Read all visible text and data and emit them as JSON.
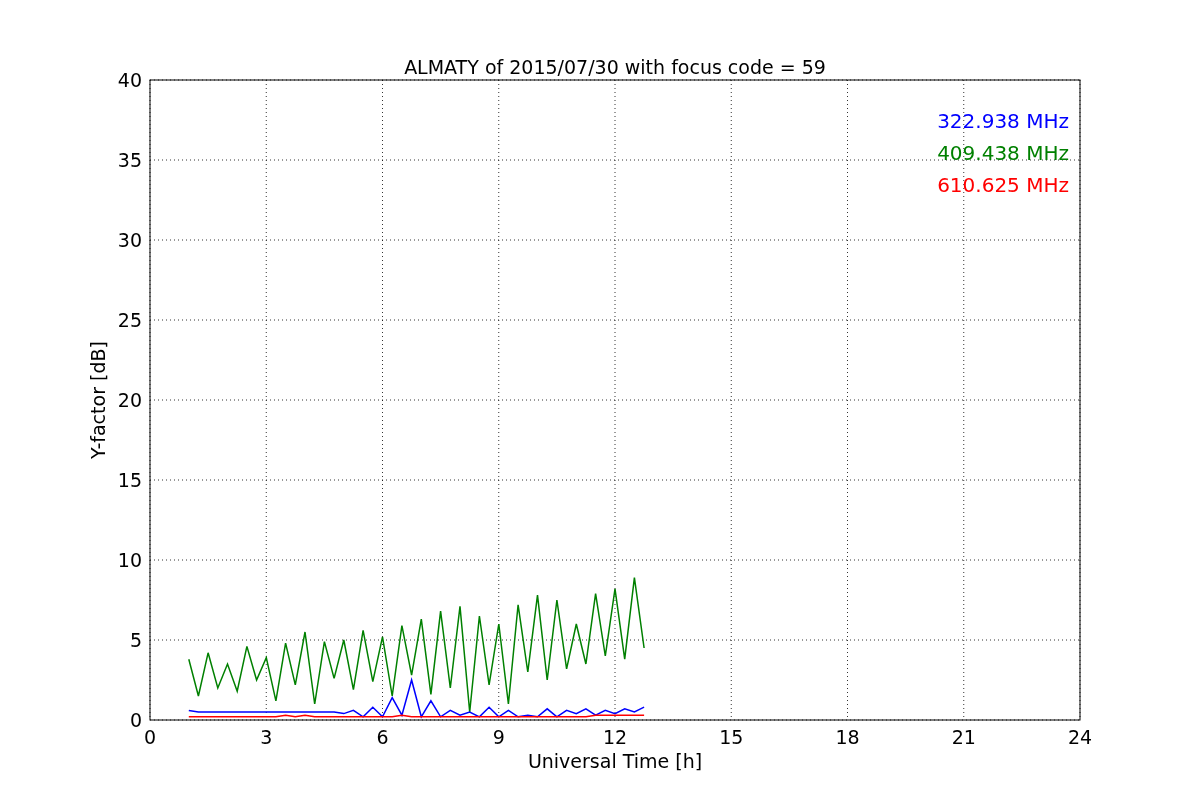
{
  "chart_data": {
    "type": "line",
    "title": "ALMATY of 2015/07/30 with focus code = 59",
    "xlabel": "Universal Time [h]",
    "ylabel": "Y-factor [dB]",
    "xlim": [
      0,
      24
    ],
    "ylim": [
      0,
      40
    ],
    "xticks": [
      0,
      3,
      6,
      9,
      12,
      15,
      18,
      21,
      24
    ],
    "yticks": [
      0,
      5,
      10,
      15,
      20,
      25,
      30,
      35,
      40
    ],
    "grid": true,
    "x": [
      1.0,
      1.25,
      1.5,
      1.75,
      2.0,
      2.25,
      2.5,
      2.75,
      3.0,
      3.25,
      3.5,
      3.75,
      4.0,
      4.25,
      4.5,
      4.75,
      5.0,
      5.25,
      5.5,
      5.75,
      6.0,
      6.25,
      6.5,
      6.75,
      7.0,
      7.25,
      7.5,
      7.75,
      8.0,
      8.25,
      8.5,
      8.75,
      9.0,
      9.25,
      9.5,
      9.75,
      10.0,
      10.25,
      10.5,
      10.75,
      11.0,
      11.25,
      11.5,
      11.75,
      12.0,
      12.25,
      12.5,
      12.75
    ],
    "series": [
      {
        "name": "322.938 MHz",
        "color": "#0000ff",
        "values": [
          0.6,
          0.5,
          0.5,
          0.5,
          0.5,
          0.5,
          0.5,
          0.5,
          0.5,
          0.5,
          0.5,
          0.5,
          0.5,
          0.5,
          0.5,
          0.5,
          0.4,
          0.6,
          0.2,
          0.8,
          0.2,
          1.4,
          0.3,
          2.5,
          0.2,
          1.2,
          0.2,
          0.6,
          0.3,
          0.5,
          0.2,
          0.8,
          0.2,
          0.6,
          0.2,
          0.3,
          0.2,
          0.7,
          0.2,
          0.6,
          0.4,
          0.7,
          0.3,
          0.6,
          0.4,
          0.7,
          0.5,
          0.8
        ]
      },
      {
        "name": "409.438 MHz",
        "color": "#008000",
        "values": [
          3.8,
          1.5,
          4.2,
          2.0,
          3.5,
          1.8,
          4.6,
          2.5,
          3.9,
          1.2,
          4.8,
          2.2,
          5.5,
          1.0,
          4.9,
          2.6,
          5.0,
          1.9,
          5.6,
          2.4,
          5.2,
          1.5,
          5.9,
          2.8,
          6.3,
          1.6,
          6.8,
          2.0,
          7.1,
          0.5,
          6.5,
          2.2,
          6.0,
          1.0,
          7.2,
          3.0,
          7.8,
          2.5,
          7.5,
          3.2,
          6.0,
          3.5,
          7.9,
          4.0,
          8.2,
          3.8,
          8.9,
          4.5
        ]
      },
      {
        "name": "610.625 MHz",
        "color": "#ff0000",
        "values": [
          0.2,
          0.2,
          0.2,
          0.2,
          0.2,
          0.2,
          0.2,
          0.2,
          0.2,
          0.2,
          0.3,
          0.2,
          0.3,
          0.2,
          0.2,
          0.2,
          0.2,
          0.2,
          0.2,
          0.2,
          0.2,
          0.2,
          0.3,
          0.2,
          0.2,
          0.2,
          0.2,
          0.2,
          0.2,
          0.2,
          0.2,
          0.2,
          0.2,
          0.2,
          0.2,
          0.2,
          0.2,
          0.2,
          0.2,
          0.2,
          0.2,
          0.2,
          0.3,
          0.3,
          0.3,
          0.3,
          0.3,
          0.3
        ]
      }
    ]
  }
}
